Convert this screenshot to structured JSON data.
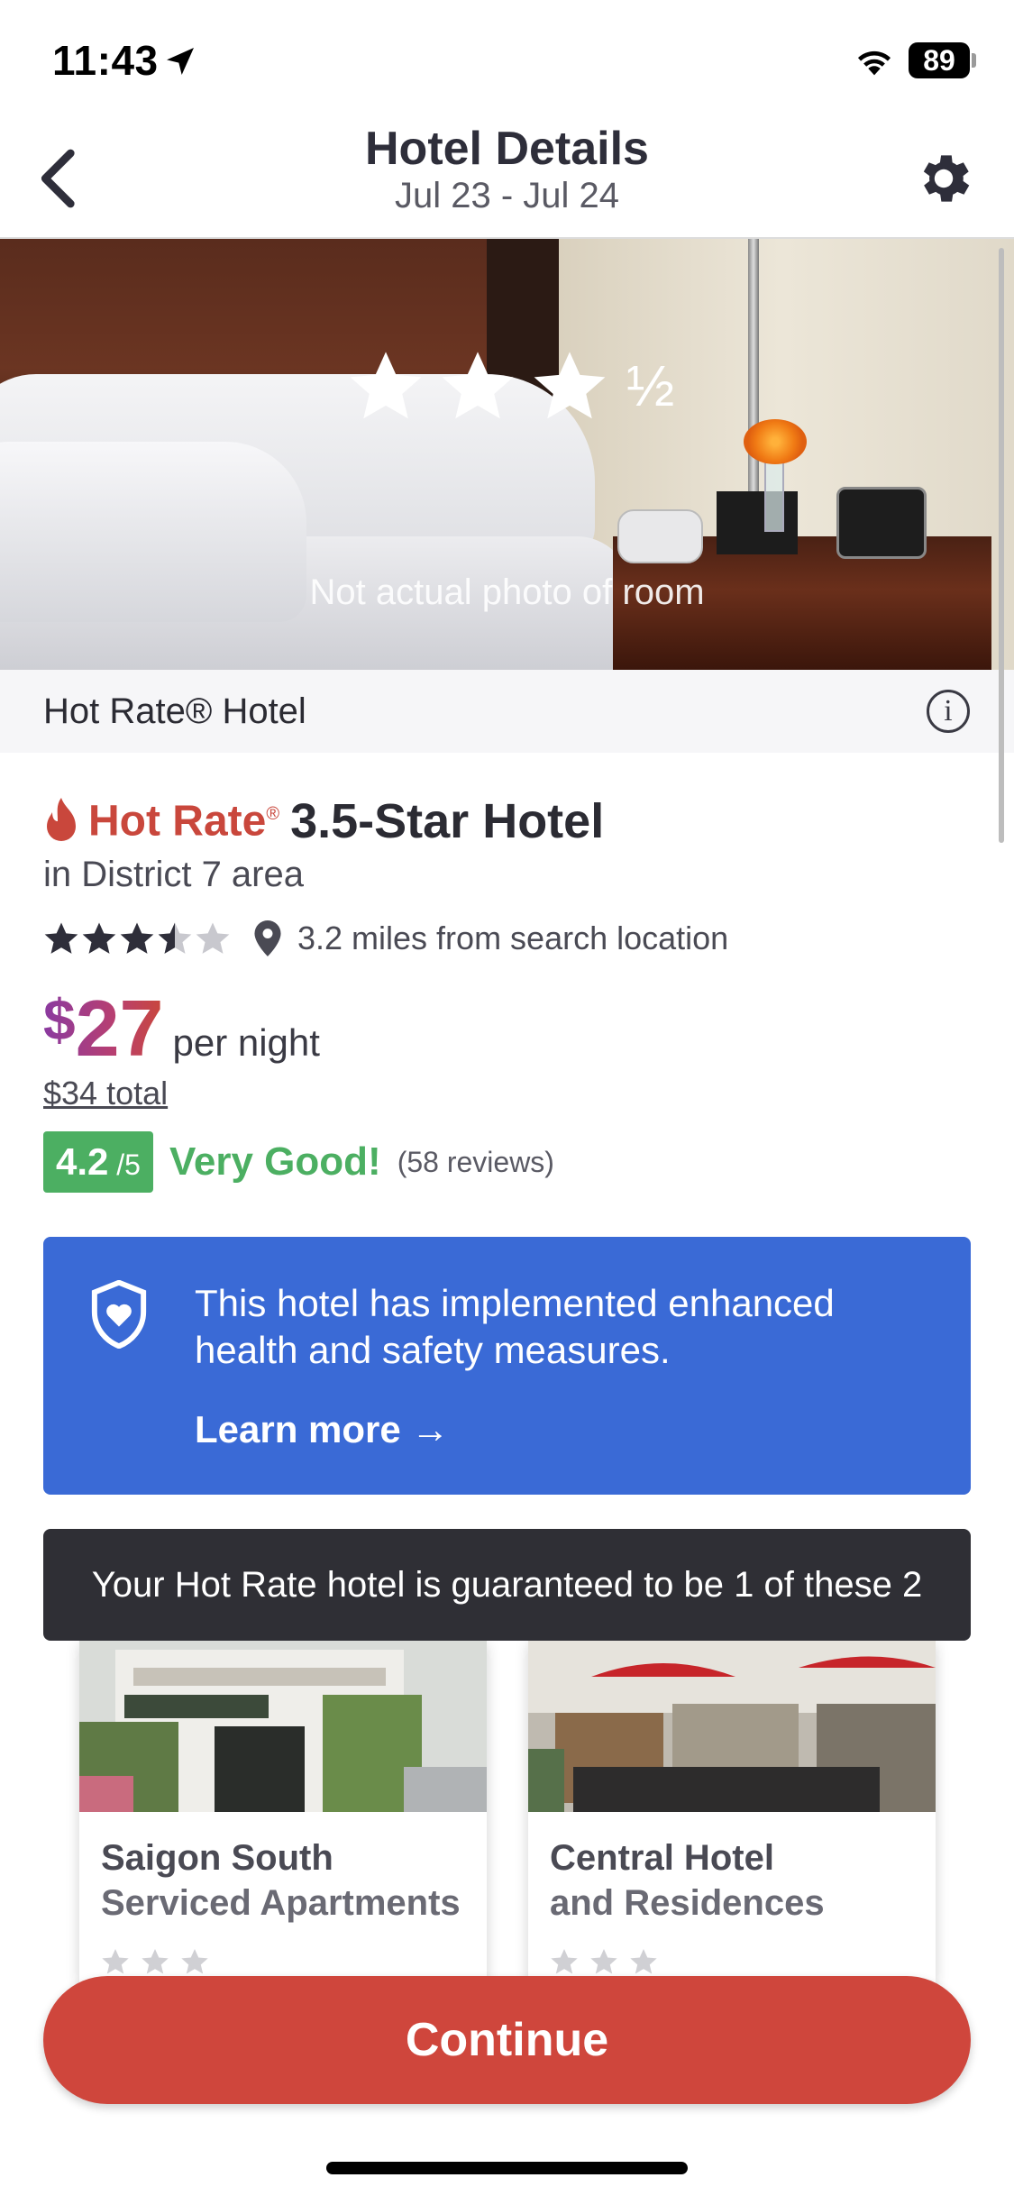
{
  "status_bar": {
    "time": "11:43",
    "battery": "89"
  },
  "nav": {
    "title": "Hotel Details",
    "dates": "Jul 23 - Jul 24",
    "icons": [
      "chevron-left-icon",
      "gear-icon"
    ]
  },
  "hero": {
    "star_half": "½",
    "caption": "Not actual photo of room",
    "star_rating": 3.5
  },
  "hot_rate_bar": {
    "label": "Hot Rate® Hotel",
    "info_glyph": "i"
  },
  "hotel": {
    "brand": "Hot Rate",
    "brand_reg": "®",
    "class": "3.5-Star Hotel",
    "area": "in District 7 area",
    "stars": 3.5,
    "distance": "3.2 miles from search location",
    "price_symbol": "$",
    "price": "27",
    "per_night": "per night",
    "total": "$34 total",
    "score": "4.2",
    "score_of": " /5",
    "score_word": "Very Good!",
    "review_count": "(58 reviews)"
  },
  "safety": {
    "text": "This hotel has implemented enhanced health and safety measures.",
    "link": "Learn more →"
  },
  "guarantee": {
    "text": "Your Hot Rate hotel is guaranteed to be 1 of these 2"
  },
  "candidates": [
    {
      "name_line1": "Saigon South",
      "name_line2": "Serviced Apartments"
    },
    {
      "name_line1": "Central Hotel",
      "name_line2": "and Residences"
    }
  ],
  "cta": {
    "label": "Continue"
  },
  "colors": {
    "accent_red": "#cf463c",
    "safety_blue": "#3a6ad6",
    "rating_green": "#4caf62",
    "price_purple": "#8a3aa0"
  }
}
